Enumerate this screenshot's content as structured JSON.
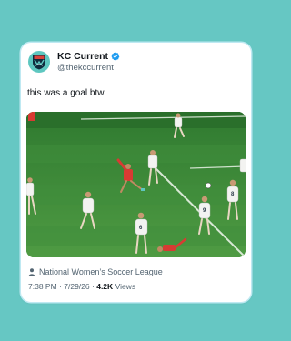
{
  "tweet": {
    "display_name": "KC Current",
    "handle": "@thekccurrent",
    "verified_icon": "verified-badge-icon",
    "avatar_icon": "kc-current-crest",
    "text": "this was a goal btw",
    "location": "National Women’s Soccer League",
    "time": "7:38 PM",
    "date": "7/29/26",
    "separator": "·",
    "views_count": "4.2K",
    "views_label": "Views"
  },
  "colors": {
    "background": "#66c7c3",
    "card": "#ffffff",
    "verified": "#1d9bf0",
    "pitch": "#3b8a3b"
  }
}
